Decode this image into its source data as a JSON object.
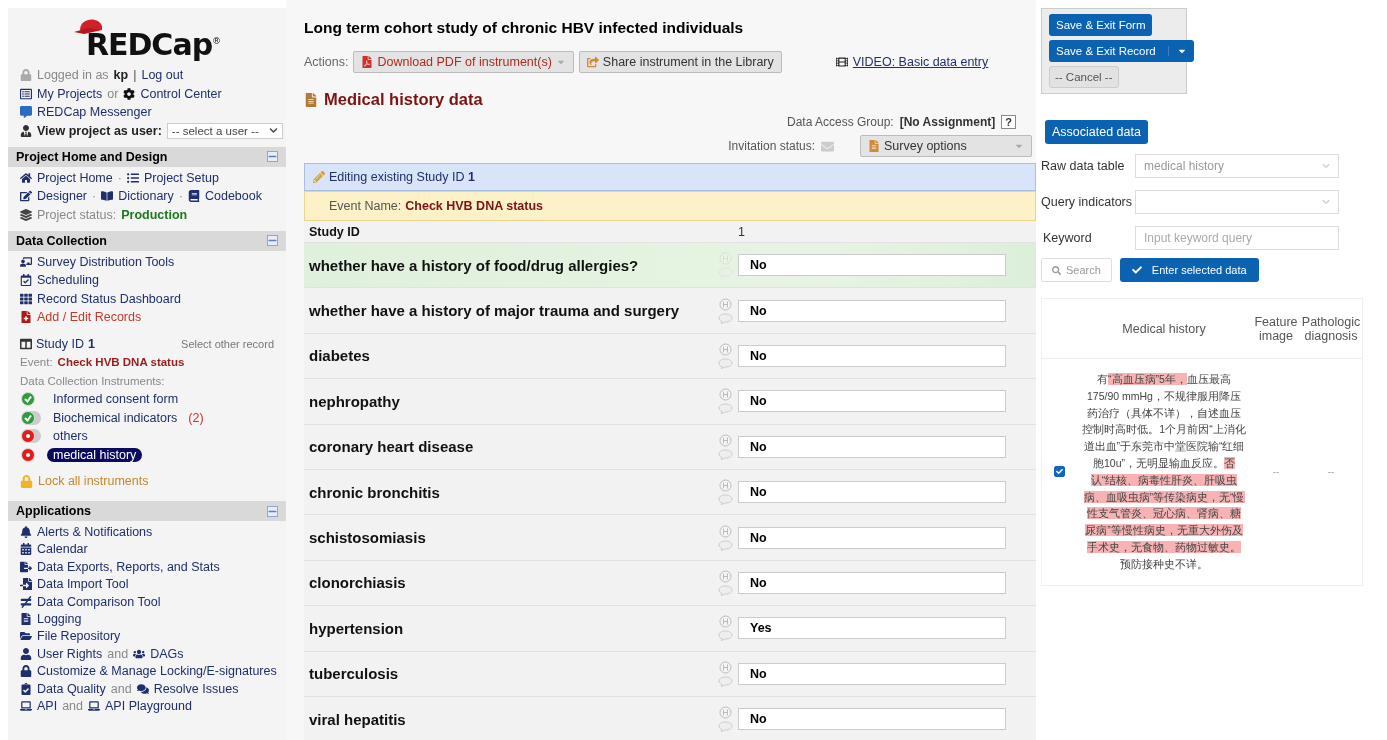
{
  "logo": {
    "text": "REDCap",
    "registered": "®"
  },
  "user_bar": {
    "logged_in": "Logged in as",
    "user": "kp",
    "separator": "|",
    "logout": "Log out"
  },
  "top_links": {
    "my_projects": "My Projects",
    "or": "or",
    "control_center": "Control Center",
    "messenger": "REDCap Messenger"
  },
  "view_as": {
    "label": "View project as user:",
    "select": "-- select a user --"
  },
  "project_home": {
    "title": "Project Home and Design",
    "separator": "·",
    "link_rows": [
      [
        "Project Home",
        "Project Setup"
      ],
      [
        "Designer",
        "Dictionary",
        "Codebook"
      ]
    ],
    "status_label": "Project status:",
    "status": "Production"
  },
  "data_collection": {
    "title": "Data Collection",
    "links": [
      {
        "text": "Survey Distribution Tools",
        "active": false
      },
      {
        "text": "Scheduling",
        "active": false
      },
      {
        "text": "Record Status Dashboard",
        "active": false
      },
      {
        "text": "Add / Edit Records",
        "active": true
      }
    ],
    "record_label": "Study ID",
    "record_id": "1",
    "select_other": "Select other record",
    "event_label": "Event:",
    "event": "Check HVB DNA status",
    "instruments_label": "Data Collection Instruments:",
    "instruments": [
      {
        "name": "Informed consent form",
        "complete": true,
        "stacked": false,
        "selected": false
      },
      {
        "name": "Biochemical indicators",
        "complete": true,
        "stacked": true,
        "count": "(2)",
        "selected": false
      },
      {
        "name": "others",
        "complete": false,
        "stacked": true,
        "selected": false
      },
      {
        "name": "medical history",
        "complete": false,
        "stacked": false,
        "selected": true
      }
    ],
    "lock": "Lock all instruments"
  },
  "applications": {
    "title": "Applications",
    "items": [
      {
        "text": "Alerts & Notifications"
      },
      {
        "text": "Calendar"
      },
      {
        "text": "Data Exports, Reports, and Stats"
      },
      {
        "text": "Data Import Tool"
      },
      {
        "text": "Data Comparison Tool"
      },
      {
        "text": "Logging"
      },
      {
        "text": "File Repository"
      },
      {
        "text": "User Rights",
        "joiner": "and",
        "second": "DAGs"
      },
      {
        "text": "Customize & Manage Locking/E-signatures"
      },
      {
        "text": "Data Quality",
        "joiner": "and",
        "second": "Resolve Issues"
      },
      {
        "text": "API",
        "joiner": "and",
        "second": "API Playground"
      }
    ]
  },
  "main": {
    "title": "Long term cohort study of chronic HBV infected individuals",
    "actions_label": "Actions:",
    "download": "Download PDF of instrument(s)",
    "share": "Share instrument in the Library",
    "video": "VIDEO: Basic data entry",
    "form_title": "Medical history data",
    "dag_label": "Data Access Group:",
    "dag_value": "[No Assignment]",
    "help": "?",
    "invitation_label": "Invitation status:",
    "survey_options": "Survey options",
    "editing": "Editing existing Study ID **1**",
    "event_label": "Event Name:",
    "event": "Check HVB DNA status",
    "id_label": "Study ID",
    "id_value": "1",
    "fields": [
      {
        "label": "whether have a history of food/drug allergies?",
        "value": "No",
        "highlighted": true
      },
      {
        "label": "whether have a history of major trauma and surgery",
        "value": "No",
        "highlighted": false
      },
      {
        "label": "diabetes",
        "value": "No",
        "highlighted": false
      },
      {
        "label": "nephropathy",
        "value": "No",
        "highlighted": false
      },
      {
        "label": "coronary heart disease",
        "value": "No",
        "highlighted": false
      },
      {
        "label": "chronic bronchitis",
        "value": "No",
        "highlighted": false
      },
      {
        "label": "schistosomiasis",
        "value": "No",
        "highlighted": false
      },
      {
        "label": "clonorchiasis",
        "value": "No",
        "highlighted": false
      },
      {
        "label": "hypertension",
        "value": "Yes",
        "highlighted": false
      },
      {
        "label": "tuberculosis",
        "value": "No",
        "highlighted": false
      },
      {
        "label": "viral hepatitis",
        "value": "No",
        "highlighted": false
      }
    ]
  },
  "right": {
    "save_form": "Save & Exit Form",
    "save_record": "Save & Exit Record",
    "cancel": "-- Cancel --",
    "associated": "Associated data",
    "raw_label": "Raw data table",
    "raw_value": "medical history",
    "query_label": "Query indicators",
    "keyword_label": "Keyword",
    "keyword_placeholder": "Input keyword query",
    "search": "Search",
    "enter": "Enter selected data",
    "columns": [
      "Medical history",
      "Feature image",
      "Pathologic diagnosis"
    ],
    "row": {
      "checked": true,
      "segments": [
        {
          "text": "有",
          "highlighted": false
        },
        {
          "text": "“高血压病”5年，",
          "highlighted": true
        },
        {
          "text": "血压最高175/90 mmHg，不规律服用降压药治疗（具体不详），自述血压控制时高时低。1个月前因“上消化道出血”于东莞市中堂医院输“红细胞10u”，无明显输血反应。",
          "highlighted": false
        },
        {
          "text": "否认“结核、病毒性肝炎、肝吸虫病、血吸虫病”等传染病史，无“慢性支气管炎、冠心病、肾病、糖尿病”等慢性病史，无重大外伤及手术史，无食物、药物过敏史。",
          "highlighted": true
        },
        {
          "text": "预防接种史不详。",
          "highlighted": false
        }
      ],
      "feature": "--",
      "pathologic": "--"
    }
  }
}
